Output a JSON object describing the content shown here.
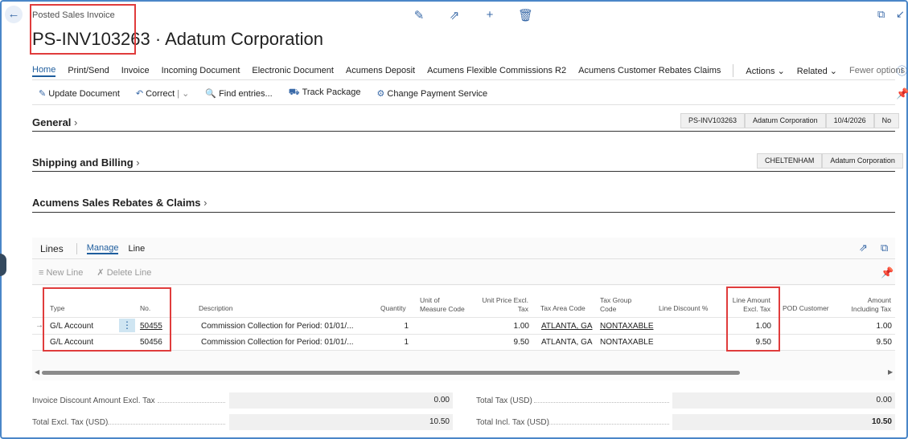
{
  "header": {
    "caption": "Posted Sales Invoice",
    "title_id": "PS-INV103263",
    "title_sep": " · ",
    "title_customer": "Adatum Corporation"
  },
  "icons": {
    "back": "arrow-left-icon",
    "edit": "pencil-icon",
    "share": "share-icon",
    "add": "plus-icon",
    "delete": "trash-icon",
    "open_new": "open-new-window-icon",
    "collapse": "collapse-icon",
    "info": "info-icon",
    "pin": "pin-icon"
  },
  "nav": {
    "items": [
      "Home",
      "Print/Send",
      "Invoice",
      "Incoming Document",
      "Electronic Document",
      "Acumens Deposit",
      "Acumens Flexible Commissions R2",
      "Acumens Customer Rebates Claims"
    ],
    "actions": "Actions",
    "related": "Related",
    "fewer": "Fewer options"
  },
  "actions": {
    "update": "Update Document",
    "correct": "Correct",
    "find": "Find entries...",
    "track": "Track Package",
    "change_payment": "Change Payment Service"
  },
  "general": {
    "title": "General",
    "chips": [
      "PS-INV103263",
      "Adatum Corporation",
      "10/4/2026",
      "No"
    ]
  },
  "shipping": {
    "title": "Shipping and Billing",
    "chips": [
      "CHELTENHAM",
      "Adatum Corporation"
    ]
  },
  "rebates": {
    "title": "Acumens Sales Rebates & Claims"
  },
  "lines": {
    "title": "Lines",
    "tab_manage": "Manage",
    "tab_line": "Line",
    "new_line": "New Line",
    "delete_line": "Delete Line",
    "columns": {
      "type": "Type",
      "no": "No.",
      "description": "Description",
      "quantity": "Quantity",
      "uom_1": "Unit of",
      "uom_2": "Measure Code",
      "price_1": "Unit Price Excl.",
      "price_2": "Tax",
      "tax_area": "Tax Area Code",
      "tax_group_1": "Tax Group",
      "tax_group_2": "Code",
      "discount": "Line Discount %",
      "amount_1": "Line Amount",
      "amount_2": "Excl. Tax",
      "pod": "POD Customer",
      "incl_1": "Amount",
      "incl_2": "Including Tax"
    },
    "rows": [
      {
        "type": "G/L Account",
        "no": "50455",
        "description": "Commission Collection for Period: 01/01/...",
        "quantity": "1",
        "unit_price": "1.00",
        "tax_area": "ATLANTA, GA",
        "tax_group": "NONTAXABLE",
        "line_amount": "1.00",
        "amount_incl": "1.00"
      },
      {
        "type": "G/L Account",
        "no": "50456",
        "description": "Commission Collection for Period: 01/01/...",
        "quantity": "1",
        "unit_price": "9.50",
        "tax_area": "ATLANTA, GA",
        "tax_group": "NONTAXABLE",
        "line_amount": "9.50",
        "amount_incl": "9.50"
      }
    ]
  },
  "totals": {
    "inv_discount_label": "Invoice Discount Amount Excl. Tax",
    "inv_discount": "0.00",
    "total_tax_label": "Total Tax (USD)",
    "total_tax": "0.00",
    "total_excl_label": "Total Excl. Tax (USD)",
    "total_excl": "10.50",
    "total_incl_label": "Total Incl. Tax (USD)",
    "total_incl": "10.50"
  }
}
